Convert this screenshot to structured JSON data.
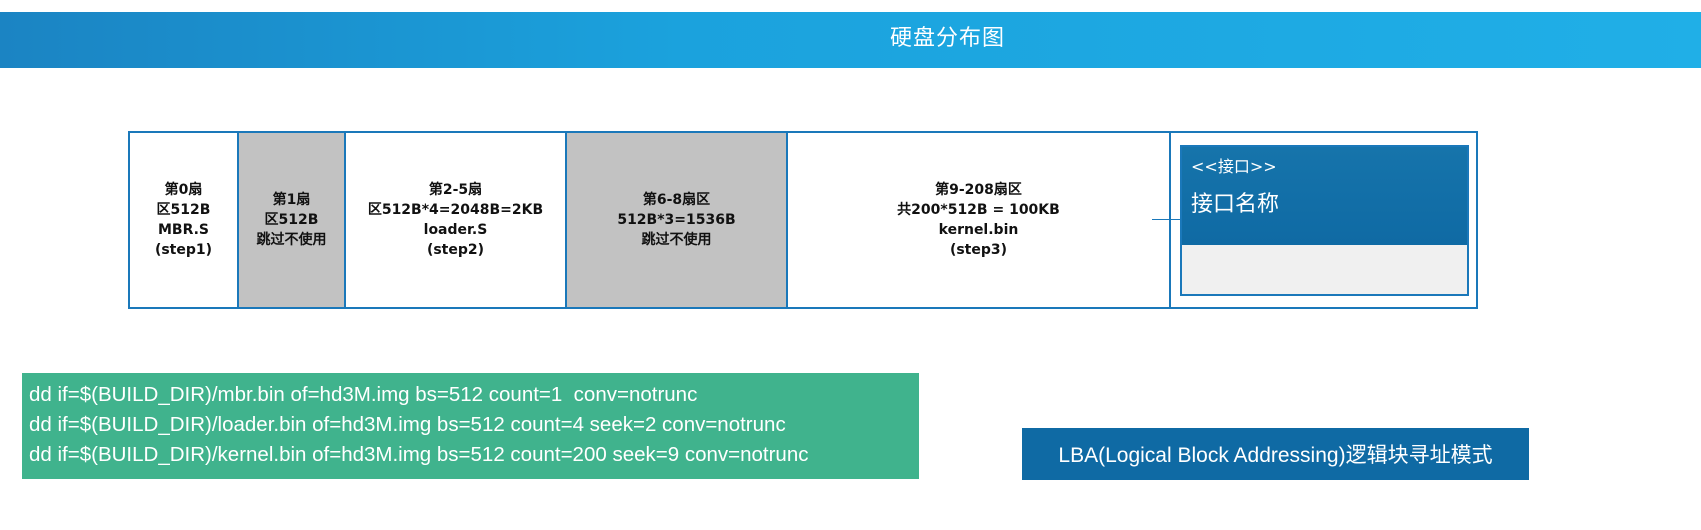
{
  "title": "硬盘分布图",
  "disk_segments": [
    {
      "text": "第0扇\n区512B\nMBR.S\n(step1)",
      "shaded": false
    },
    {
      "text": "第1扇\n区512B\n跳过不使用",
      "shaded": true
    },
    {
      "text": "第2-5扇\n区512B*4=2048B=2KB\nloader.S\n(step2)",
      "shaded": false
    },
    {
      "text": "第6-8扇区\n512B*3=1536B\n跳过不使用",
      "shaded": true
    },
    {
      "text": "第9-208扇区\n共200*512B = 100KB\nkernel.bin\n(step3)",
      "shaded": false
    }
  ],
  "interface_card": {
    "stereotype": "<<接口>>",
    "name": "接口名称"
  },
  "commands": [
    "dd if=$(BUILD_DIR)/mbr.bin of=hd3M.img bs=512 count=1  conv=notrunc",
    "dd if=$(BUILD_DIR)/loader.bin of=hd3M.img bs=512 count=4 seek=2 conv=notrunc",
    "dd if=$(BUILD_DIR)/kernel.bin of=hd3M.img bs=512 count=200 seek=9 conv=notrunc"
  ],
  "lba_label": "LBA(Logical Block Addressing)逻辑块寻址模式",
  "colors": {
    "title_bar": "#1ba2dd",
    "border_blue": "#1a78ba",
    "shaded_segment": "#c2c2c2",
    "command_box": "#40b38d",
    "lba_box": "#0f6aa4",
    "interface_header": "#1674ab"
  }
}
